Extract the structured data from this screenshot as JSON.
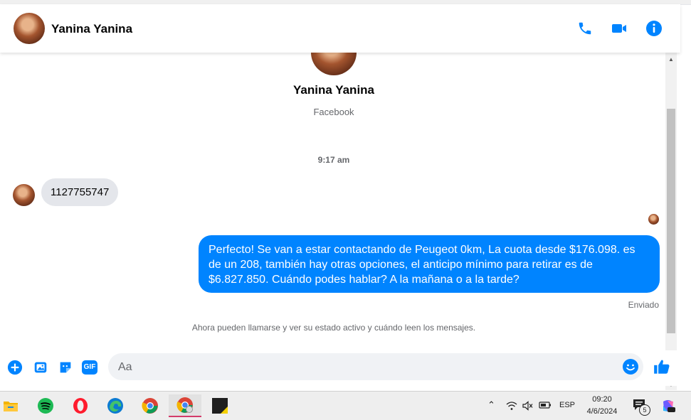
{
  "header": {
    "contact_name": "Yanina Yanina",
    "icons": [
      "phone-icon",
      "video-call-icon",
      "info-icon"
    ]
  },
  "profile": {
    "name": "Yanina Yanina",
    "subtitle": "Facebook"
  },
  "conversation": {
    "timestamp": "9:17 am",
    "incoming_message": "1127755747",
    "outgoing_message": "Perfecto!  Se van a estar contactando de Peugeot 0km, La cuota desde $176.098. es de un 208, también hay otras opciones, el anticipo mínimo para retirar es de $6.827.850. Cuándo podes hablar? A la mañana o a la tarde?",
    "sent_status": "Enviado",
    "info_text": "Ahora pueden llamarse y ver su estado activo y cuándo leen los mensajes."
  },
  "composer": {
    "placeholder": "Aa",
    "value": "",
    "gif_label": "GIF"
  },
  "taskbar": {
    "language": "ESP",
    "time": "09:20",
    "date": "4/6/2024",
    "notification_count": "5"
  },
  "colors": {
    "accent": "#0084ff",
    "outgoing_bubble": "#0084ff",
    "incoming_bubble": "#e4e6eb"
  }
}
